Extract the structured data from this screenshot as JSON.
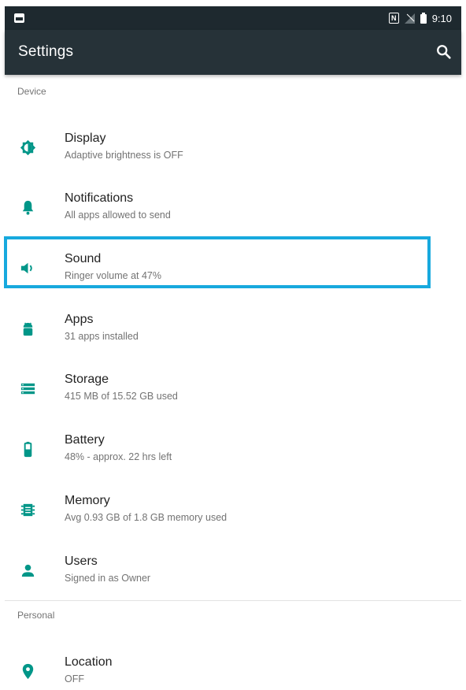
{
  "colors": {
    "accent": "#009688",
    "status_bar": "#1e292f",
    "app_bar": "#263238",
    "highlight": "#17a9de"
  },
  "status_bar": {
    "time": "9:10",
    "icons": [
      "notification-image-icon",
      "nfc-icon",
      "no-signal-icon",
      "battery-icon"
    ]
  },
  "app_bar": {
    "title": "Settings",
    "search_icon": "search-icon"
  },
  "sections": {
    "device": "Device",
    "personal": "Personal"
  },
  "items": [
    {
      "title": "Display",
      "subtitle": "Adaptive brightness is OFF",
      "icon": "brightness-icon"
    },
    {
      "title": "Notifications",
      "subtitle": "All apps allowed to send",
      "icon": "bell-icon"
    },
    {
      "title": "Sound",
      "subtitle": "Ringer volume at 47%",
      "icon": "volume-icon"
    },
    {
      "title": "Apps",
      "subtitle": "31 apps installed",
      "icon": "android-icon"
    },
    {
      "title": "Storage",
      "subtitle": "415 MB of 15.52 GB used",
      "icon": "storage-icon"
    },
    {
      "title": "Battery",
      "subtitle": "48% - approx. 22 hrs left",
      "icon": "battery-icon"
    },
    {
      "title": "Memory",
      "subtitle": "Avg 0.93 GB of 1.8 GB memory used",
      "icon": "memory-icon"
    },
    {
      "title": "Users",
      "subtitle": "Signed in as Owner",
      "icon": "user-icon"
    },
    {
      "title": "Location",
      "subtitle": "OFF",
      "icon": "location-icon"
    }
  ]
}
